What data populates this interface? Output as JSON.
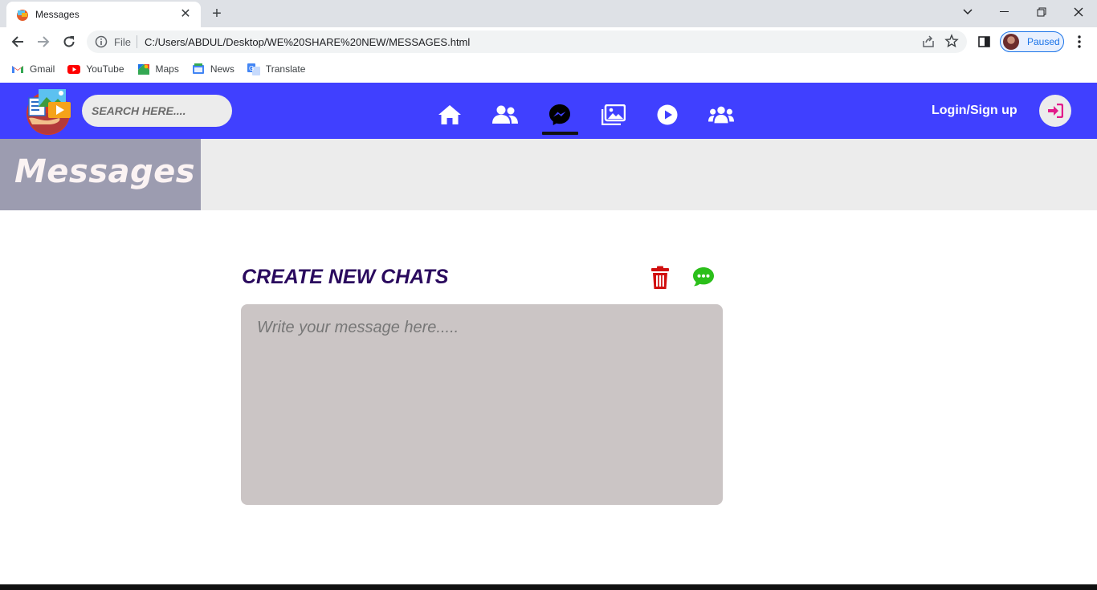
{
  "browser": {
    "tab_title": "Messages",
    "new_tab": "+",
    "omnibox_scheme": "File",
    "url": "C:/Users/ABDUL/Desktop/WE%20SHARE%20NEW/MESSAGES.html",
    "profile_status": "Paused",
    "bookmarks": [
      "Gmail",
      "YouTube",
      "Maps",
      "News",
      "Translate"
    ]
  },
  "header": {
    "search_placeholder": "SEARCH HERE....",
    "nav_items": [
      "home-icon",
      "friends-icon",
      "messenger-icon",
      "photos-icon",
      "video-play-icon",
      "groups-icon"
    ],
    "active_nav": "messenger-icon",
    "login_label": "Login/Sign up",
    "accent_color": "#4040ff"
  },
  "banner": {
    "title": "Messages"
  },
  "main": {
    "heading": "CREATE NEW CHATS",
    "composer_placeholder": "Write your message here.....",
    "delete_icon_color": "#d10f0f",
    "chat_icon_color": "#2bbf1a"
  }
}
